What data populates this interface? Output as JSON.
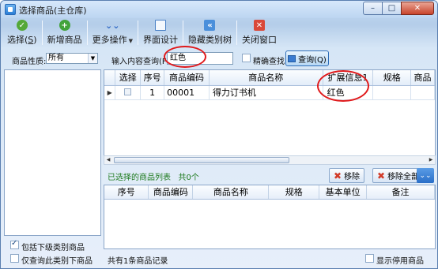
{
  "window": {
    "title": "选择商品(主仓库)",
    "minimize": "–",
    "maximize": "□",
    "close": "✕"
  },
  "toolbar": {
    "select_label": "选择(",
    "select_key": "S",
    "select_suffix": ")",
    "add_label": "新增商品",
    "more_label": "更多操作",
    "design_label": "界面设计",
    "hide_tree_label": "隐藏类别树",
    "close_label": "关闭窗口"
  },
  "filter": {
    "category_label": "商品性质:",
    "category_value": "所有",
    "query_label": "输入内容查询(F4):",
    "query_value": "红色",
    "exact_label": "精确查找",
    "query_button": "查询(Q)"
  },
  "results": {
    "columns": [
      "选择",
      "序号",
      "商品编码",
      "商品名称",
      "扩展信息1",
      "规格",
      "商品"
    ],
    "rows": [
      {
        "index": "1",
        "code": "00001",
        "name": "得力订书机",
        "ext1": "红色",
        "spec": ""
      }
    ]
  },
  "selected": {
    "title": "已选择的商品列表",
    "count_text": "共0个",
    "remove_button": "移除",
    "remove_all_button": "移除全部",
    "columns": [
      "序号",
      "商品编码",
      "商品名称",
      "规格",
      "基本单位",
      "备注"
    ]
  },
  "left": {
    "include_sub_label": "包括下级类别商品",
    "only_this_label": "仅查询此类别下商品"
  },
  "status": {
    "record_text": "共有1条商品记录",
    "show_disabled_label": "显示停用商品"
  },
  "colors": {
    "highlight_ring": "#e0191b",
    "accent": "#2a6fc8"
  }
}
